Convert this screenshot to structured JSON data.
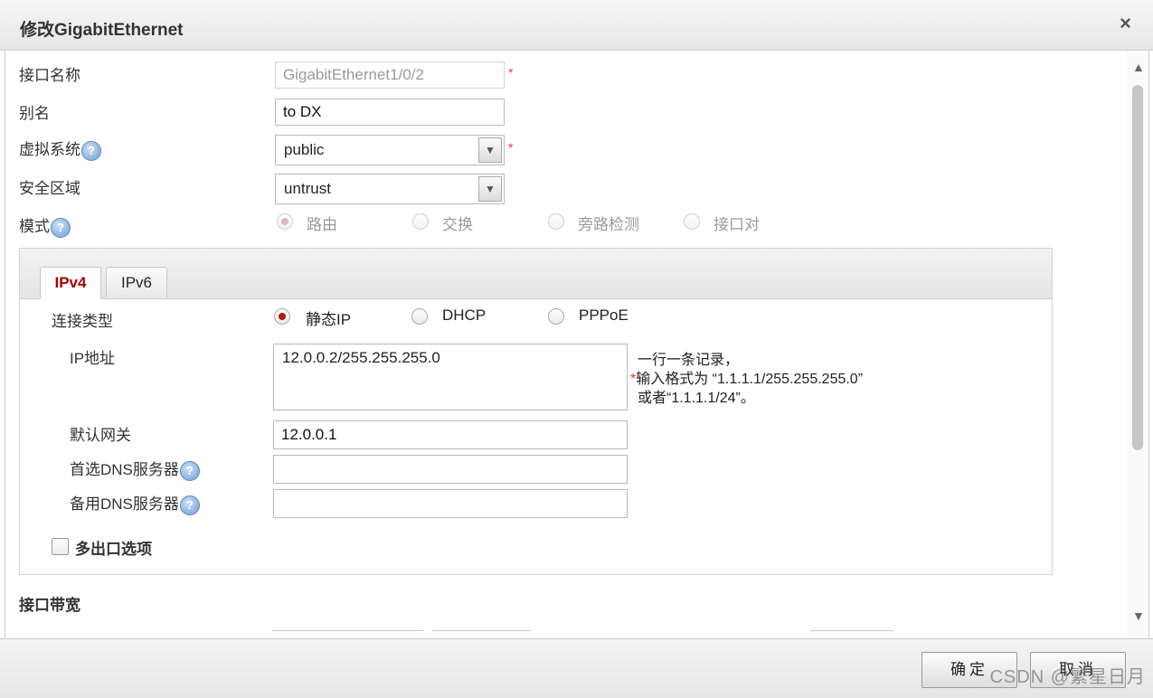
{
  "dialog": {
    "title": "修改GigabitEthernet",
    "close": "×"
  },
  "form": {
    "interface_name": {
      "label": "接口名称",
      "value": "GigabitEthernet1/0/2",
      "required": "*"
    },
    "alias": {
      "label": "别名",
      "value": "to DX"
    },
    "virtual_system": {
      "label": "虚拟系统",
      "value": "public",
      "required": "*"
    },
    "security_zone": {
      "label": "安全区域",
      "value": "untrust"
    },
    "mode": {
      "label": "模式",
      "options": [
        "路由",
        "交换",
        "旁路检测",
        "接口对"
      ],
      "selected": "路由"
    }
  },
  "tabs": {
    "items": [
      "IPv4",
      "IPv6"
    ],
    "active": "IPv4"
  },
  "ipv4": {
    "connection_type": {
      "label": "连接类型",
      "options": [
        "静态IP",
        "DHCP",
        "PPPoE"
      ],
      "selected": "静态IP"
    },
    "ip_address": {
      "label": "IP地址",
      "value": "12.0.0.2/255.255.255.0",
      "hint_line1": "一行一条记录，",
      "hint_star": "*",
      "hint_line2": "输入格式为 “1.1.1.1/255.255.255.0”",
      "hint_line3": "或者“1.1.1.1/24”。"
    },
    "gateway": {
      "label": "默认网关",
      "value": "12.0.0.1"
    },
    "dns_primary": {
      "label": "首选DNS服务器",
      "value": ""
    },
    "dns_backup": {
      "label": "备用DNS服务器",
      "value": ""
    },
    "multi_exit": {
      "label": "多出口选项",
      "checked": false
    }
  },
  "bandwidth": {
    "label": "接口带宽"
  },
  "help_icon": "?",
  "scroll": {
    "up": "▲",
    "down": "▼"
  },
  "footer": {
    "ok": "确定",
    "cancel": "取消"
  },
  "watermark": "CSDN @繁星日月"
}
